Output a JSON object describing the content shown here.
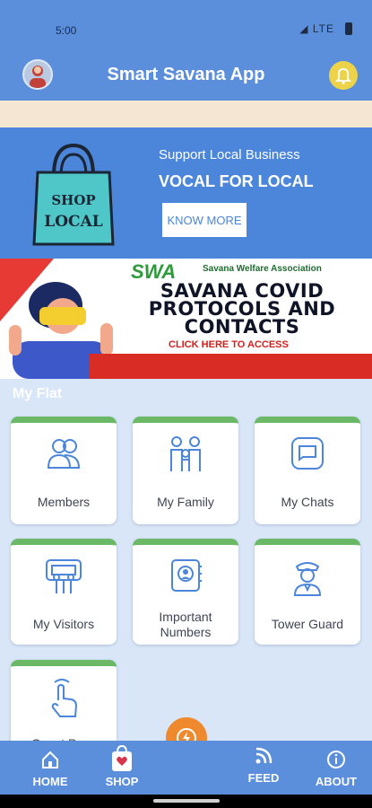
{
  "status": {
    "time": "5:00",
    "network": "LTE"
  },
  "header": {
    "title": "Smart Savana App"
  },
  "banner_local": {
    "bag_text_line1": "SHOP",
    "bag_text_line2": "LOCAL",
    "tagline": "Support Local Business",
    "headline": "VOCAL FOR LOCAL",
    "button_label": "KNOW MORE"
  },
  "banner_covid": {
    "logo_text": "SWA",
    "association": "Savana Welfare Association",
    "title_line1": "SAVANA COVID",
    "title_line2": "PROTOCOLS AND",
    "title_line3": "CONTACTS",
    "cta": "CLICK HERE TO ACCESS"
  },
  "section": {
    "title": "My Flat"
  },
  "tiles": [
    {
      "label": "Members",
      "icon": "members-icon"
    },
    {
      "label": "My Family",
      "icon": "family-icon"
    },
    {
      "label": "My Chats",
      "icon": "chat-icon"
    },
    {
      "label": "My Visitors",
      "icon": "visitors-icon"
    },
    {
      "label": "Important Numbers",
      "icon": "phonebook-icon"
    },
    {
      "label": "Tower Guard",
      "icon": "guard-icon"
    },
    {
      "label": "Guest Pass",
      "icon": "tap-icon"
    }
  ],
  "bottom_nav": {
    "home": "HOME",
    "shop": "SHOP",
    "feed": "FEED",
    "about": "ABOUT"
  },
  "colors": {
    "primary": "#5b8fdc",
    "tile_accent": "#6bb867",
    "fab": "#ee8a2d",
    "bell": "#ecd34a"
  }
}
